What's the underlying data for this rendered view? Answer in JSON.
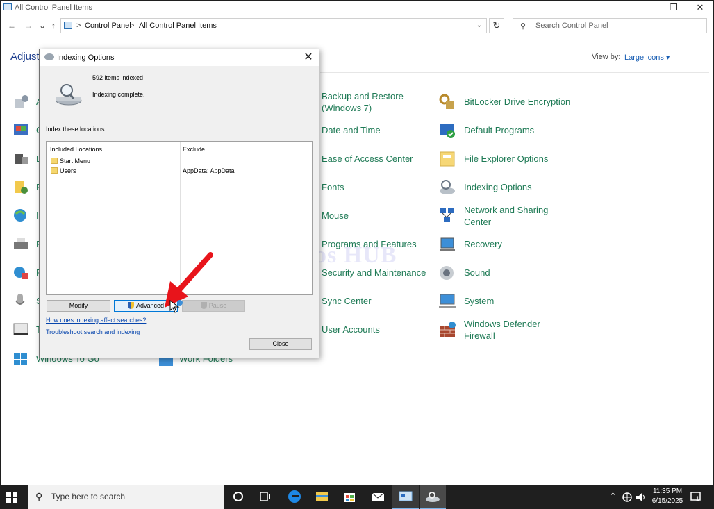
{
  "window": {
    "title": "All Control Panel Items",
    "minimize": "—",
    "restore": "❐",
    "close": "✕"
  },
  "nav": {
    "back": "←",
    "forward": "→",
    "recent": "⌄",
    "up": "↑",
    "breadcrumbs": [
      "Control Panel",
      "All Control Panel Items"
    ],
    "separator": ">",
    "dropdown": "⌄",
    "refresh": "↻",
    "search_placeholder": "Search Control Panel"
  },
  "header": {
    "adjust_text": "Adjust y",
    "view_by_label": "View by:",
    "view_by_value": "Large icons ▾"
  },
  "items": {
    "col3": [
      {
        "label": "Backup and Restore (Windows 7)",
        "icon": "backup-restore-icon"
      },
      {
        "label": "Date and Time",
        "icon": "date-time-icon"
      },
      {
        "label": "Ease of Access Center",
        "icon": "ease-of-access-icon"
      },
      {
        "label": "Fonts",
        "icon": "fonts-icon"
      },
      {
        "label": "Mouse",
        "icon": "mouse-icon"
      },
      {
        "label": "Programs and Features",
        "icon": "programs-features-icon"
      },
      {
        "label": "Security and Maintenance",
        "icon": "security-maintenance-icon"
      },
      {
        "label": "Sync Center",
        "icon": "sync-center-icon"
      },
      {
        "label": "User Accounts",
        "icon": "user-accounts-icon"
      }
    ],
    "col4": [
      {
        "label": "BitLocker Drive Encryption",
        "icon": "bitlocker-icon"
      },
      {
        "label": "Default Programs",
        "icon": "default-programs-icon"
      },
      {
        "label": "File Explorer Options",
        "icon": "file-explorer-options-icon"
      },
      {
        "label": "Indexing Options",
        "icon": "indexing-options-icon"
      },
      {
        "label": "Network and Sharing Center",
        "icon": "network-sharing-icon"
      },
      {
        "label": "Recovery",
        "icon": "recovery-icon"
      },
      {
        "label": "Sound",
        "icon": "sound-icon"
      },
      {
        "label": "System",
        "icon": "system-icon"
      },
      {
        "label": "Windows Defender Firewall",
        "icon": "firewall-icon"
      }
    ],
    "col1_partial": [
      {
        "label": "A"
      },
      {
        "label": "C"
      },
      {
        "label": "D"
      },
      {
        "label": "F"
      },
      {
        "label": "I"
      },
      {
        "label": "P"
      },
      {
        "label": "R"
      },
      {
        "label": "S"
      },
      {
        "label": "T"
      }
    ],
    "bottom": [
      {
        "label": "Windows To Go",
        "icon": "windows-to-go-icon"
      },
      {
        "label": "Work Folders",
        "icon": "work-folders-icon"
      }
    ]
  },
  "dialog": {
    "title": "Indexing Options",
    "close": "✕",
    "items_indexed": "592 items indexed",
    "status": "Indexing complete.",
    "index_label": "Index these locations:",
    "col_included": "Included Locations",
    "col_exclude": "Exclude",
    "locations": [
      {
        "name": "Start Menu",
        "exclude": ""
      },
      {
        "name": "Users",
        "exclude": "AppData; AppData"
      }
    ],
    "modify": "Modify",
    "advanced": "Advanced",
    "pause": "Pause",
    "link_how": "How does indexing affect searches?",
    "link_troubleshoot": "Troubleshoot search and indexing",
    "close_btn": "Close"
  },
  "watermark": "IT Pros HUB",
  "taskbar": {
    "search_placeholder": "Type here to search",
    "time": "11:35 PM",
    "date": "6/15/2025",
    "tray_up": "⌃",
    "notifications": "1"
  },
  "colors": {
    "link_green": "#1e7a55",
    "accent_blue": "#0078d7",
    "taskbar": "#1f1f1f",
    "arrow_red": "#e8141b"
  }
}
